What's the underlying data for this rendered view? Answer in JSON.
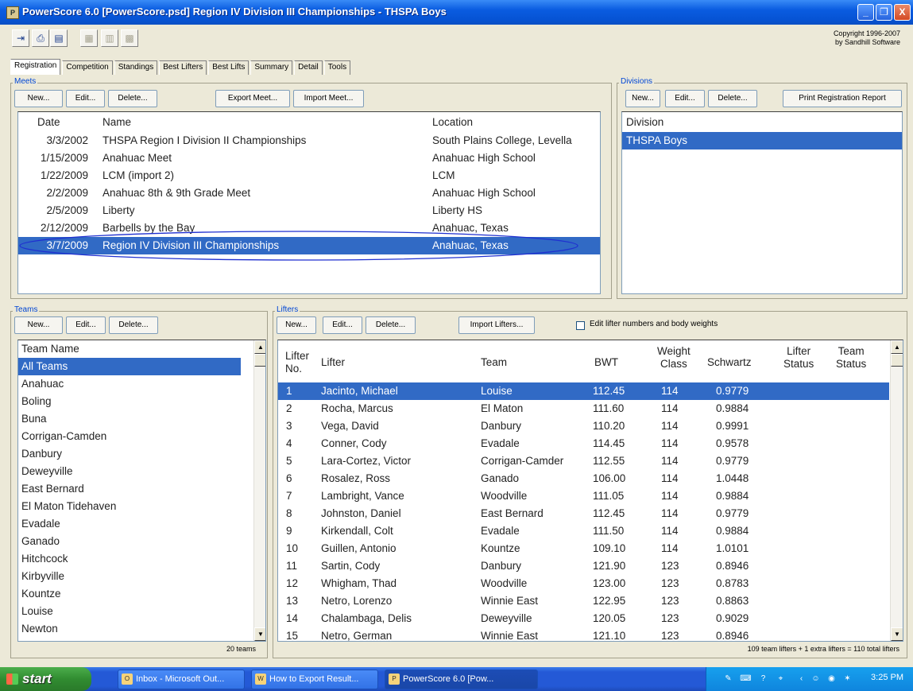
{
  "window": {
    "title": "PowerScore 6.0 [PowerScore.psd] Region IV Division III Championships - THSPA Boys",
    "minimize": "_",
    "restore": "❐",
    "close": "X"
  },
  "toolbar": {
    "copyright_line1": "Copyright 1996-2007",
    "copyright_line2": "by Sandhill Software"
  },
  "tabs": [
    "Registration",
    "Competition",
    "Standings",
    "Best Lifters",
    "Best Lifts",
    "Summary",
    "Detail",
    "Tools"
  ],
  "meets": {
    "title": "Meets",
    "buttons": {
      "new": "New...",
      "edit": "Edit...",
      "delete": "Delete...",
      "export": "Export Meet...",
      "import": "Import Meet..."
    },
    "columns": {
      "date": "Date",
      "name": "Name",
      "location": "Location"
    },
    "rows": [
      {
        "date": "3/3/2002",
        "name": "THSPA Region I Division II Championships",
        "location": "South Plains College, Levella"
      },
      {
        "date": "1/15/2009",
        "name": "Anahuac Meet",
        "location": "Anahuac High School"
      },
      {
        "date": "1/22/2009",
        "name": "LCM (import 2)",
        "location": "LCM"
      },
      {
        "date": "2/2/2009",
        "name": "Anahuac 8th & 9th Grade Meet",
        "location": "Anahuac High School"
      },
      {
        "date": "2/5/2009",
        "name": "Liberty",
        "location": "Liberty HS"
      },
      {
        "date": "2/12/2009",
        "name": "Barbells by the Bay",
        "location": "Anahuac, Texas"
      },
      {
        "date": "3/7/2009",
        "name": "Region IV Division III Championships",
        "location": "Anahuac, Texas"
      }
    ],
    "selected_index": 6,
    "highlight_color": "#1f2fd0"
  },
  "divisions": {
    "title": "Divisions",
    "buttons": {
      "new": "New...",
      "edit": "Edit...",
      "delete": "Delete...",
      "print": "Print Registration Report"
    },
    "column": "Division",
    "rows": [
      "THSPA Boys"
    ]
  },
  "teams": {
    "title": "Teams",
    "buttons": {
      "new": "New...",
      "edit": "Edit...",
      "delete": "Delete..."
    },
    "column": "Team Name",
    "rows": [
      "All Teams",
      "Anahuac",
      "Boling",
      "Buna",
      "Corrigan-Camden",
      "Danbury",
      "Deweyville",
      "East Bernard",
      "El Maton Tidehaven",
      "Evadale",
      "Ganado",
      "Hitchcock",
      "Kirbyville",
      "Kountze",
      "Louise",
      "Newton"
    ],
    "count": "20 teams"
  },
  "lifters": {
    "title": "Lifters",
    "buttons": {
      "new": "New...",
      "edit": "Edit...",
      "delete": "Delete...",
      "import": "Import Lifters..."
    },
    "checkbox_label": "Edit lifter numbers and body weights",
    "columns": {
      "no_line1": "Lifter",
      "no_line2": "No.",
      "lifter": "Lifter",
      "team": "Team",
      "bwt": "BWT",
      "wc_line1": "Weight",
      "wc_line2": "Class",
      "schwartz": "Schwartz",
      "ls_line1": "Lifter",
      "ls_line2": "Status",
      "ts_line1": "Team",
      "ts_line2": "Status"
    },
    "rows": [
      {
        "no": "1",
        "name": "Jacinto, Michael",
        "team": "Louise",
        "bwt": "112.45",
        "wc": "114",
        "schwartz": "0.9779"
      },
      {
        "no": "2",
        "name": "Rocha, Marcus",
        "team": "El Maton",
        "bwt": "111.60",
        "wc": "114",
        "schwartz": "0.9884"
      },
      {
        "no": "3",
        "name": "Vega, David",
        "team": "Danbury",
        "bwt": "110.20",
        "wc": "114",
        "schwartz": "0.9991"
      },
      {
        "no": "4",
        "name": "Conner, Cody",
        "team": "Evadale",
        "bwt": "114.45",
        "wc": "114",
        "schwartz": "0.9578"
      },
      {
        "no": "5",
        "name": "Lara-Cortez, Victor",
        "team": "Corrigan-Camder",
        "bwt": "112.55",
        "wc": "114",
        "schwartz": "0.9779"
      },
      {
        "no": "6",
        "name": "Rosalez, Ross",
        "team": "Ganado",
        "bwt": "106.00",
        "wc": "114",
        "schwartz": "1.0448"
      },
      {
        "no": "7",
        "name": "Lambright, Vance",
        "team": "Woodville",
        "bwt": "111.05",
        "wc": "114",
        "schwartz": "0.9884"
      },
      {
        "no": "8",
        "name": "Johnston, Daniel",
        "team": "East Bernard",
        "bwt": "112.45",
        "wc": "114",
        "schwartz": "0.9779"
      },
      {
        "no": "9",
        "name": "Kirkendall, Colt",
        "team": "Evadale",
        "bwt": "111.50",
        "wc": "114",
        "schwartz": "0.9884"
      },
      {
        "no": "10",
        "name": "Guillen, Antonio",
        "team": "Kountze",
        "bwt": "109.10",
        "wc": "114",
        "schwartz": "1.0101"
      },
      {
        "no": "11",
        "name": "Sartin, Cody",
        "team": "Danbury",
        "bwt": "121.90",
        "wc": "123",
        "schwartz": "0.8946"
      },
      {
        "no": "12",
        "name": "Whigham, Thad",
        "team": "Woodville",
        "bwt": "123.00",
        "wc": "123",
        "schwartz": "0.8783"
      },
      {
        "no": "13",
        "name": "Netro, Lorenzo",
        "team": "Winnie East",
        "bwt": "122.95",
        "wc": "123",
        "schwartz": "0.8863"
      },
      {
        "no": "14",
        "name": "Chalambaga, Delis",
        "team": "Deweyville",
        "bwt": "120.05",
        "wc": "123",
        "schwartz": "0.9029"
      },
      {
        "no": "15",
        "name": "Netro, German",
        "team": "Winnie East",
        "bwt": "121.10",
        "wc": "123",
        "schwartz": "0.8946"
      }
    ],
    "summary": "109 team lifters + 1 extra lifters = 110 total lifters"
  },
  "taskbar": {
    "start": "start",
    "tasks": [
      "Inbox - Microsoft Out...",
      "How to Export Result...",
      "PowerScore 6.0 [Pow..."
    ],
    "clock": "3:25 PM"
  },
  "colors": {
    "selection": "#316ac5",
    "titlebar": "#0653d4",
    "group_title": "#0046d5"
  }
}
